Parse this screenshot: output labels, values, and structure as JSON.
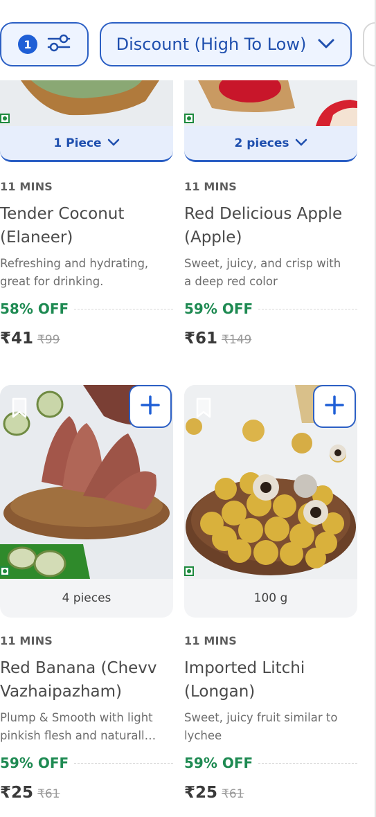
{
  "filter_bar": {
    "filter_count": "1",
    "sort_label": "Discount (High To Low)"
  },
  "products": [
    {
      "quantity": "1 Piece",
      "delivery": "11 MINS",
      "name_line1": "Tender Coconut",
      "name_line2": "(Elaneer)",
      "desc_line1": "Refreshing and hydrating,",
      "desc_line2": "great for drinking.",
      "discount": "58% OFF",
      "price": "₹41",
      "mrp": "₹99"
    },
    {
      "quantity": "2 pieces",
      "delivery": "11 MINS",
      "name_line1": "Red Delicious Apple",
      "name_line2": "(Apple)",
      "desc_line1": "Sweet, juicy, and crisp with",
      "desc_line2": "a deep red color",
      "discount": "59% OFF",
      "price": "₹61",
      "mrp": "₹149"
    },
    {
      "quantity": "4 pieces",
      "delivery": "11 MINS",
      "name_line1": "Red Banana (Chevv",
      "name_line2": "Vazhaipazham)",
      "desc_line1": "Plump & Smooth with light",
      "desc_line2": "pinkish flesh and naturall…",
      "discount": "59% OFF",
      "price": "₹25",
      "mrp": "₹61"
    },
    {
      "quantity": "100 g",
      "delivery": "11 MINS",
      "name_line1": "Imported Litchi",
      "name_line2": "(Longan)",
      "desc_line1": "Sweet, juicy fruit similar to",
      "desc_line2": "lychee",
      "discount": "59% OFF",
      "price": "₹25",
      "mrp": "₹61"
    }
  ],
  "icons": {
    "filter": "sliders-icon",
    "sort_chevron": "chevron-down-icon",
    "add": "plus-icon",
    "wishlist": "bookmark-icon",
    "veg": "veg-indicator-icon"
  },
  "colors": {
    "accent": "#1f5fd6",
    "discount_green": "#1e8a52",
    "veg_green": "#1e8a3e"
  }
}
